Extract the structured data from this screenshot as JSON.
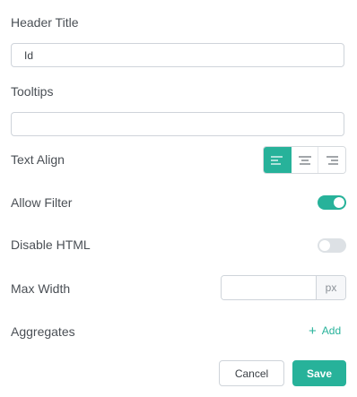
{
  "header_title": {
    "label": "Header Title",
    "value": "Id"
  },
  "tooltips": {
    "label": "Tooltips",
    "value": ""
  },
  "text_align": {
    "label": "Text Align",
    "options": [
      "align-left-icon",
      "align-center-icon",
      "align-right-icon"
    ],
    "selected": "left"
  },
  "allow_filter": {
    "label": "Allow Filter",
    "enabled": true
  },
  "disable_html": {
    "label": "Disable HTML",
    "enabled": false
  },
  "max_width": {
    "label": "Max Width",
    "value": "",
    "unit": "px"
  },
  "aggregates": {
    "label": "Aggregates",
    "add_label": "Add"
  },
  "footer": {
    "cancel_label": "Cancel",
    "save_label": "Save"
  },
  "colors": {
    "accent": "#27b29a",
    "toggle_off": "#dde1e5",
    "border": "#cfd4da"
  }
}
